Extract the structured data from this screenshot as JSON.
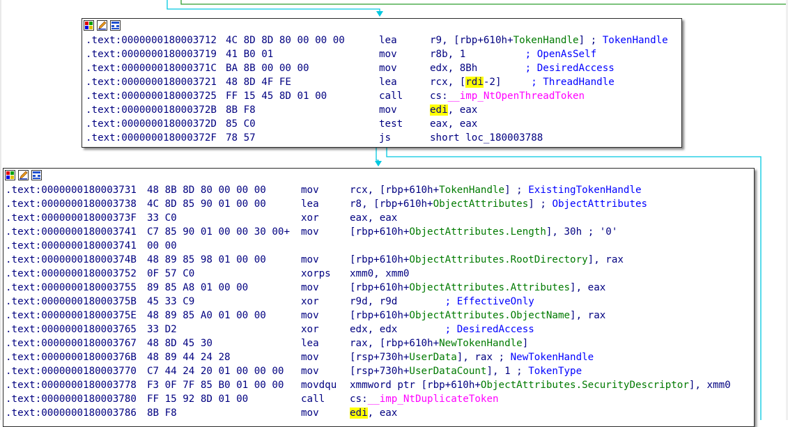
{
  "colors": {
    "flow_edge": "#00c8e0",
    "green_edge": "#2e9e2e",
    "highlight": "#ffff00",
    "address": "#000080",
    "symbol": "#007a00",
    "comment": "#0000ff",
    "import": "#ff00ff"
  },
  "node1": {
    "icons": [
      "color-palette-icon",
      "edit-icon",
      "graph-icon"
    ],
    "lines": [
      {
        "addr": ".text:0000000180003712",
        "bytes": "4C 8D 8D 80 00 00 00",
        "mn": "lea",
        "ops": [
          {
            "t": "r9, [rbp+610h+",
            "c": "m"
          },
          {
            "t": "TokenHandle",
            "c": "g"
          },
          {
            "t": "] ; ",
            "c": "m"
          },
          {
            "t": "TokenHandle",
            "c": "b"
          }
        ]
      },
      {
        "addr": ".text:0000000180003719",
        "bytes": "41 B0 01",
        "mn": "mov",
        "ops": [
          {
            "t": "r8b, 1          ",
            "c": "m"
          },
          {
            "t": "; OpenAsSelf",
            "c": "b"
          }
        ]
      },
      {
        "addr": ".text:000000018000371C",
        "bytes": "BA 8B 00 00 00",
        "mn": "mov",
        "ops": [
          {
            "t": "edx, 8Bh        ",
            "c": "m"
          },
          {
            "t": "; DesiredAccess",
            "c": "b"
          }
        ]
      },
      {
        "addr": ".text:0000000180003721",
        "bytes": "48 8D 4F FE",
        "mn": "lea",
        "ops": [
          {
            "t": "rcx, [",
            "c": "m"
          },
          {
            "t": "rdi",
            "c": "m",
            "hl": true
          },
          {
            "t": "-2]     ",
            "c": "m"
          },
          {
            "t": "; ThreadHandle",
            "c": "b"
          }
        ]
      },
      {
        "addr": ".text:0000000180003725",
        "bytes": "FF 15 45 8D 01 00",
        "mn": "call",
        "ops": [
          {
            "t": "cs:",
            "c": "m"
          },
          {
            "t": "__imp_NtOpenThreadToken",
            "c": "p"
          }
        ]
      },
      {
        "addr": ".text:000000018000372B",
        "bytes": "8B F8",
        "mn": "mov",
        "ops": [
          {
            "t": "edi",
            "c": "m",
            "hl": true
          },
          {
            "t": ", eax",
            "c": "m"
          }
        ]
      },
      {
        "addr": ".text:000000018000372D",
        "bytes": "85 C0",
        "mn": "test",
        "ops": [
          {
            "t": "eax, eax",
            "c": "m"
          }
        ]
      },
      {
        "addr": ".text:000000018000372F",
        "bytes": "78 57",
        "mn": "js",
        "ops": [
          {
            "t": "short loc_180003788",
            "c": "m"
          }
        ]
      }
    ]
  },
  "node2": {
    "icons": [
      "color-palette-icon",
      "edit-icon",
      "graph-icon"
    ],
    "lines": [
      {
        "addr": ".text:0000000180003731",
        "bytes": "48 8B 8D 80 00 00 00",
        "mn": "mov",
        "ops": [
          {
            "t": "rcx, [rbp+610h+",
            "c": "m"
          },
          {
            "t": "TokenHandle",
            "c": "g"
          },
          {
            "t": "] ; ",
            "c": "m"
          },
          {
            "t": "ExistingTokenHandle",
            "c": "b"
          }
        ]
      },
      {
        "addr": ".text:0000000180003738",
        "bytes": "4C 8D 85 90 01 00 00",
        "mn": "lea",
        "ops": [
          {
            "t": "r8, [rbp+610h+",
            "c": "m"
          },
          {
            "t": "ObjectAttributes",
            "c": "g"
          },
          {
            "t": "] ; ",
            "c": "m"
          },
          {
            "t": "ObjectAttributes",
            "c": "b"
          }
        ]
      },
      {
        "addr": ".text:000000018000373F",
        "bytes": "33 C0",
        "mn": "xor",
        "ops": [
          {
            "t": "eax, eax",
            "c": "m"
          }
        ]
      },
      {
        "addr": ".text:0000000180003741",
        "bytes": "C7 85 90 01 00 00 30 00+",
        "mn": "mov",
        "ops": [
          {
            "t": "[rbp+610h+",
            "c": "m"
          },
          {
            "t": "ObjectAttributes.Length",
            "c": "g"
          },
          {
            "t": "], 30h ",
            "c": "m"
          },
          {
            "t": "; '0'",
            "c": "k"
          }
        ]
      },
      {
        "addr": ".text:0000000180003741",
        "bytes": "00 00",
        "mn": "",
        "ops": []
      },
      {
        "addr": ".text:000000018000374B",
        "bytes": "48 89 85 98 01 00 00",
        "mn": "mov",
        "ops": [
          {
            "t": "[rbp+610h+",
            "c": "m"
          },
          {
            "t": "ObjectAttributes.RootDirectory",
            "c": "g"
          },
          {
            "t": "], rax",
            "c": "m"
          }
        ]
      },
      {
        "addr": ".text:0000000180003752",
        "bytes": "0F 57 C0",
        "mn": "xorps",
        "ops": [
          {
            "t": "xmm0, xmm0",
            "c": "m"
          }
        ]
      },
      {
        "addr": ".text:0000000180003755",
        "bytes": "89 85 A8 01 00 00",
        "mn": "mov",
        "ops": [
          {
            "t": "[rbp+610h+",
            "c": "m"
          },
          {
            "t": "ObjectAttributes.Attributes",
            "c": "g"
          },
          {
            "t": "], eax",
            "c": "m"
          }
        ]
      },
      {
        "addr": ".text:000000018000375B",
        "bytes": "45 33 C9",
        "mn": "xor",
        "ops": [
          {
            "t": "r9d, r9d        ",
            "c": "m"
          },
          {
            "t": "; EffectiveOnly",
            "c": "b"
          }
        ]
      },
      {
        "addr": ".text:000000018000375E",
        "bytes": "48 89 85 A0 01 00 00",
        "mn": "mov",
        "ops": [
          {
            "t": "[rbp+610h+",
            "c": "m"
          },
          {
            "t": "ObjectAttributes.ObjectName",
            "c": "g"
          },
          {
            "t": "], rax",
            "c": "m"
          }
        ]
      },
      {
        "addr": ".text:0000000180003765",
        "bytes": "33 D2",
        "mn": "xor",
        "ops": [
          {
            "t": "edx, edx        ",
            "c": "m"
          },
          {
            "t": "; DesiredAccess",
            "c": "b"
          }
        ]
      },
      {
        "addr": ".text:0000000180003767",
        "bytes": "48 8D 45 30",
        "mn": "lea",
        "ops": [
          {
            "t": "rax, [rbp+610h+",
            "c": "m"
          },
          {
            "t": "NewTokenHandle",
            "c": "g"
          },
          {
            "t": "]",
            "c": "m"
          }
        ]
      },
      {
        "addr": ".text:000000018000376B",
        "bytes": "48 89 44 24 28",
        "mn": "mov",
        "ops": [
          {
            "t": "[rsp+730h+",
            "c": "m"
          },
          {
            "t": "UserData",
            "c": "g"
          },
          {
            "t": "], rax ; ",
            "c": "m"
          },
          {
            "t": "NewTokenHandle",
            "c": "b"
          }
        ]
      },
      {
        "addr": ".text:0000000180003770",
        "bytes": "C7 44 24 20 01 00 00 00",
        "mn": "mov",
        "ops": [
          {
            "t": "[rsp+730h+",
            "c": "m"
          },
          {
            "t": "UserDataCount",
            "c": "g"
          },
          {
            "t": "], 1 ; ",
            "c": "m"
          },
          {
            "t": "TokenType",
            "c": "b"
          }
        ]
      },
      {
        "addr": ".text:0000000180003778",
        "bytes": "F3 0F 7F 85 B0 01 00 00",
        "mn": "movdqu",
        "ops": [
          {
            "t": "xmmword ptr [rbp+610h+",
            "c": "m"
          },
          {
            "t": "ObjectAttributes.SecurityDescriptor",
            "c": "g"
          },
          {
            "t": "], xmm0",
            "c": "m"
          }
        ]
      },
      {
        "addr": ".text:0000000180003780",
        "bytes": "FF 15 92 8D 01 00",
        "mn": "call",
        "ops": [
          {
            "t": "cs:",
            "c": "m"
          },
          {
            "t": "__imp_NtDuplicateToken",
            "c": "p"
          }
        ]
      },
      {
        "addr": ".text:0000000180003786",
        "bytes": "8B F8",
        "mn": "mov",
        "ops": [
          {
            "t": "edi",
            "c": "m",
            "hl": true
          },
          {
            "t": ", eax",
            "c": "m"
          }
        ]
      }
    ]
  }
}
